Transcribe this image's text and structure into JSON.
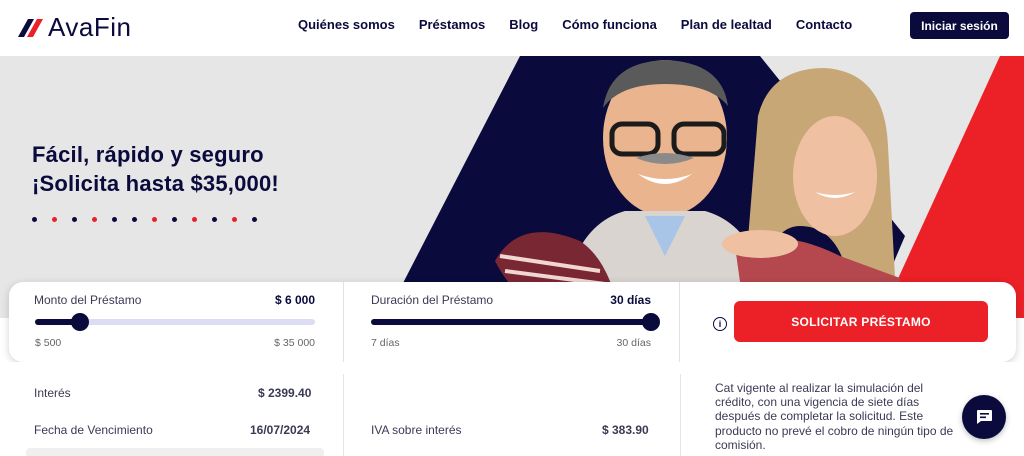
{
  "brand": {
    "name": "AvaFin",
    "accent": "#ec2027",
    "navy": "#0a0a3c"
  },
  "nav": {
    "links": [
      "Quiénes somos",
      "Préstamos",
      "Blog",
      "Cómo funciona",
      "Plan de lealtad",
      "Contacto"
    ],
    "login_label": "Iniciar sesión"
  },
  "hero": {
    "title_line1": "Fácil, rápido y seguro",
    "title_line2": "¡Solicita hasta $35,000!",
    "dot_colors": [
      "navy",
      "red",
      "navy",
      "red",
      "navy",
      "navy",
      "red",
      "navy",
      "red",
      "navy",
      "red",
      "navy"
    ]
  },
  "calculator": {
    "amount": {
      "label": "Monto del Préstamo",
      "value": "$ 6 000",
      "min_label": "$  500",
      "max_label": "$  35 000",
      "fraction": 0.16
    },
    "duration": {
      "label": "Duración del Préstamo",
      "value": "30 días",
      "min_label": "7  días",
      "max_label": "30  días",
      "fraction": 1.0
    },
    "info_icon": "info-icon",
    "apply_label": "SOLICITAR PRÉSTAMO"
  },
  "details": {
    "interest_label": "Interés",
    "interest_value": "$ 2399.40",
    "due_label": "Fecha de Vencimiento",
    "due_value": "16/07/2024",
    "iva_label": "IVA sobre interés",
    "iva_value": "$ 383.90",
    "cat_text": "Cat vigente al realizar la simulación del crédito, con una vigencia de siete días después de completar la solicitud. Este producto no prevé el cobro de ningún tipo de comisión."
  },
  "chat": {
    "icon": "chat-icon"
  }
}
